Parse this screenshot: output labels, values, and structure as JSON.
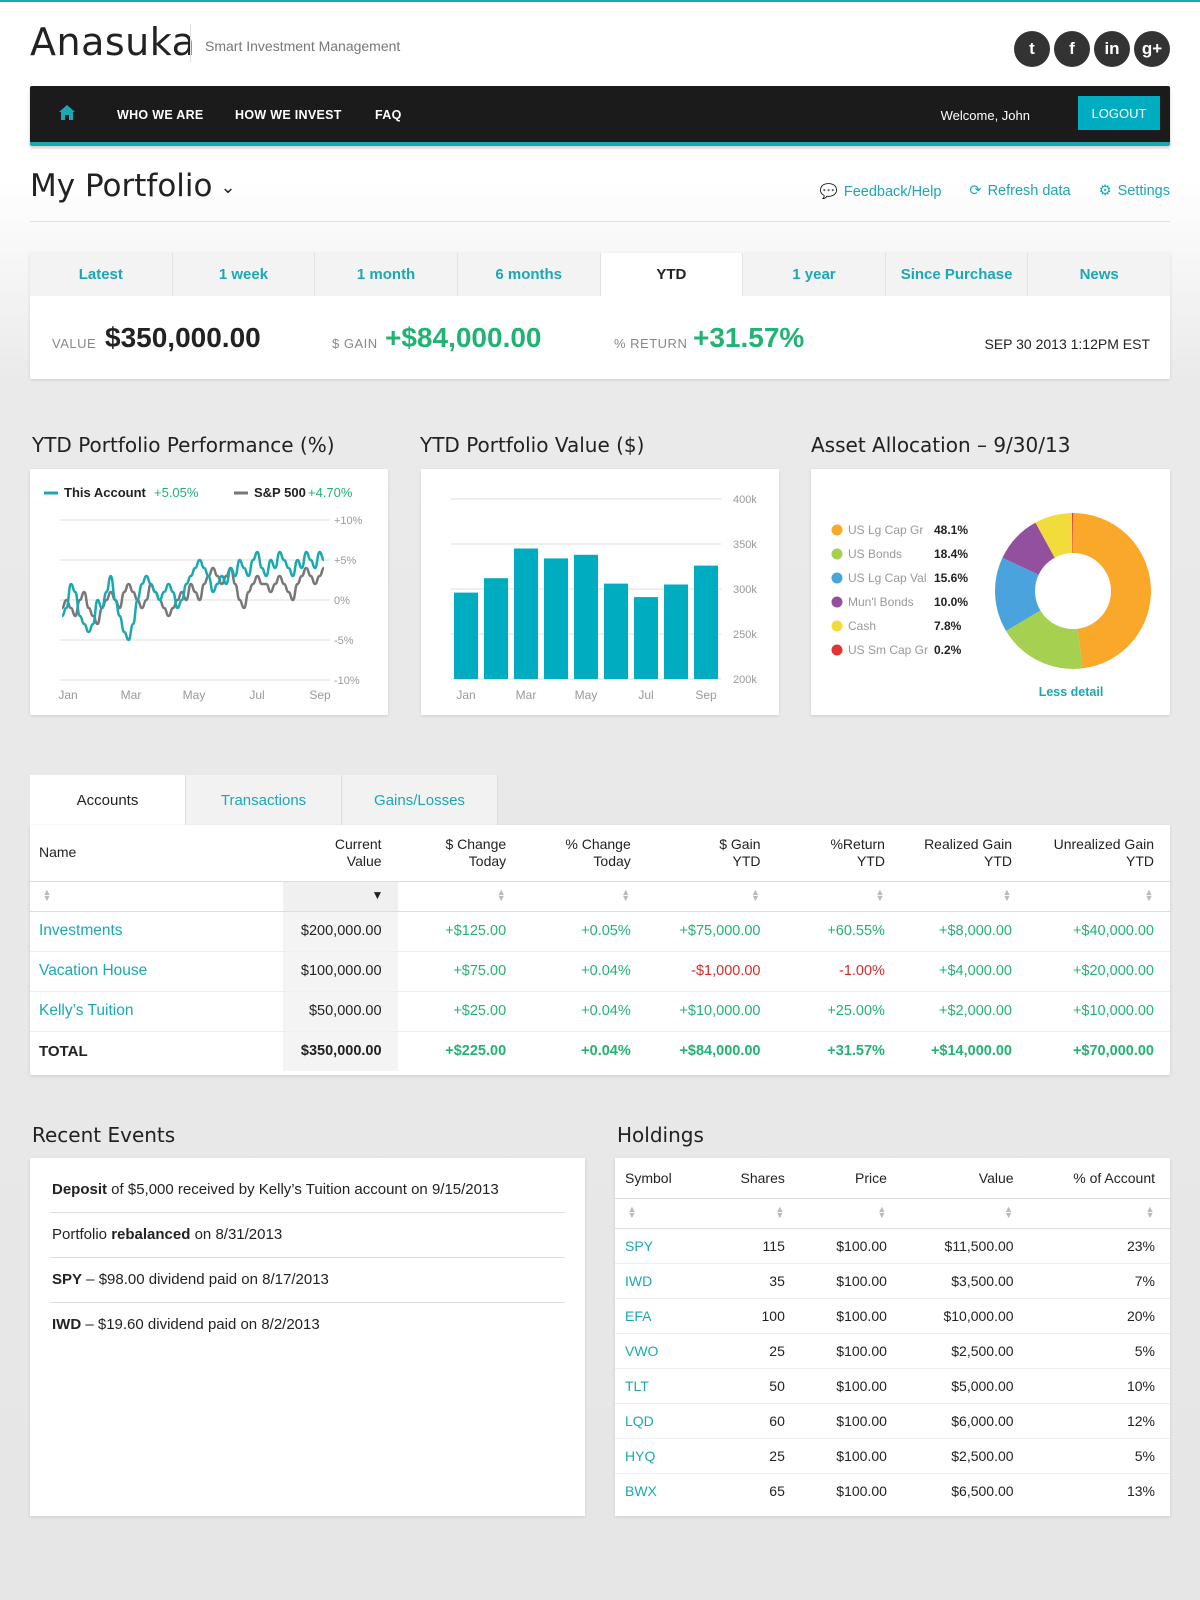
{
  "brand": {
    "name": "Anasuka",
    "tagline": "Smart Investment Management"
  },
  "social": [
    {
      "icon": "twitter-icon",
      "glyph": "t"
    },
    {
      "icon": "facebook-icon",
      "glyph": "f"
    },
    {
      "icon": "linkedin-icon",
      "glyph": "in"
    },
    {
      "icon": "googleplus-icon",
      "glyph": "g+"
    }
  ],
  "nav": {
    "items": [
      "WHO WE ARE",
      "HOW WE INVEST",
      "FAQ"
    ],
    "welcome": "Welcome, John",
    "logout": "LOGOUT"
  },
  "page": {
    "title": "My Portfolio"
  },
  "actions": {
    "feedback": "Feedback/Help",
    "refresh": "Refresh data",
    "settings": "Settings"
  },
  "time_tabs": [
    "Latest",
    "1 week",
    "1 month",
    "6 months",
    "YTD",
    "1 year",
    "Since Purchase",
    "News"
  ],
  "active_time_tab": "YTD",
  "summary": {
    "value_label": "VALUE",
    "value": "$350,000.00",
    "gain_label": "$ GAIN",
    "gain": "+$84,000.00",
    "return_label": "% RETURN",
    "return": "+31.57%",
    "date": "SEP 30 2013 1:12PM EST"
  },
  "charts": {
    "performance_title": "YTD Portfolio Performance (%)",
    "value_title": "YTD Portfolio Value ($)",
    "allocation_title": "Asset Allocation – 9/30/13",
    "less_detail": "Less detail"
  },
  "chart_data": [
    {
      "type": "line",
      "title": "YTD Portfolio Performance (%)",
      "x_ticks": [
        "Jan",
        "Mar",
        "May",
        "Jul",
        "Sep"
      ],
      "y_ticks": [
        "+10%",
        "+5%",
        "0%",
        "-5%",
        "-10%"
      ],
      "ylim": [
        -10,
        10
      ],
      "series": [
        {
          "name": "This Account",
          "legend_value": "+5.05%",
          "color": "#1aa8b3",
          "values": [
            -2,
            -1,
            2,
            1,
            -2,
            -3,
            -4,
            -3,
            0,
            -1,
            1,
            3,
            0,
            -2,
            -4,
            -5,
            -3,
            0,
            2,
            3,
            2,
            1,
            0,
            1,
            2,
            1,
            -1,
            0,
            2,
            3,
            4,
            5,
            4,
            3,
            1,
            2,
            3,
            2,
            4,
            3,
            5,
            4,
            3,
            5,
            6,
            4,
            3,
            5,
            4,
            6,
            5,
            4,
            3,
            5,
            4,
            6,
            5,
            4,
            6,
            5
          ]
        },
        {
          "name": "S&P 500",
          "legend_value": "+4.70%",
          "color": "#777777",
          "values": [
            -1,
            0,
            -1,
            -2,
            0,
            1,
            -1,
            -2,
            -3,
            -1,
            0,
            1,
            0,
            -1,
            1,
            2,
            1,
            0,
            -1,
            0,
            2,
            1,
            0,
            -1,
            -2,
            -1,
            0,
            1,
            0,
            2,
            1,
            0,
            2,
            3,
            4,
            3,
            2,
            3,
            4,
            2,
            0,
            -1,
            1,
            2,
            3,
            2,
            2,
            1,
            2,
            3,
            2,
            1,
            0,
            2,
            3,
            4,
            3,
            2,
            3,
            4
          ]
        }
      ]
    },
    {
      "type": "bar",
      "title": "YTD Portfolio Value ($)",
      "categories": [
        "Jan",
        "Feb",
        "Mar",
        "Apr",
        "May",
        "Jun",
        "Jul",
        "Aug",
        "Sep"
      ],
      "x_ticks": [
        "Jan",
        "Mar",
        "May",
        "Jul",
        "Sep"
      ],
      "y_ticks": [
        "400k",
        "350k",
        "300k",
        "250k",
        "200k"
      ],
      "values": [
        296000,
        312000,
        345000,
        334000,
        338000,
        306000,
        291000,
        305000,
        326000
      ],
      "ylim": [
        200000,
        400000
      ],
      "color": "#00adc0"
    },
    {
      "type": "pie",
      "title": "Asset Allocation – 9/30/13",
      "slices": [
        {
          "label": "US Lg Cap Gr",
          "value": 48.1,
          "display": "48.1%",
          "color": "#f9a82a"
        },
        {
          "label": "US Bonds",
          "value": 18.4,
          "display": "18.4%",
          "color": "#a6d150"
        },
        {
          "label": "US Lg Cap Val",
          "value": 15.6,
          "display": "15.6%",
          "color": "#4ba3de"
        },
        {
          "label": "Mun'l Bonds",
          "value": 10.0,
          "display": "10.0%",
          "color": "#93509e"
        },
        {
          "label": "Cash",
          "value": 7.8,
          "display": "7.8%",
          "color": "#f2dc3b"
        },
        {
          "label": "US Sm Cap Gr",
          "value": 0.2,
          "display": "0.2%",
          "color": "#e33333"
        }
      ]
    }
  ],
  "accounts": {
    "tabs": [
      "Accounts",
      "Transactions",
      "Gains/Losses"
    ],
    "columns": [
      "Name",
      "Current Value",
      "$ Change Today",
      "% Change Today",
      "$ Gain YTD",
      "%Return YTD",
      "Realized Gain YTD",
      "Unrealized Gain YTD"
    ],
    "rows": [
      {
        "name": "Investments",
        "cur": "$200,000.00",
        "chg": "+$125.00",
        "pchg": "+0.05%",
        "gain": "+$75,000.00",
        "ret": "+60.55%",
        "real": "+$8,000.00",
        "unreal": "+$40,000.00",
        "neg": false
      },
      {
        "name": "Vacation House",
        "cur": "$100,000.00",
        "chg": "+$75.00",
        "pchg": "+0.04%",
        "gain": "-$1,000.00",
        "ret": "-1.00%",
        "real": "+$4,000.00",
        "unreal": "+$20,000.00",
        "neg": true
      },
      {
        "name": "Kelly’s Tuition",
        "cur": "$50,000.00",
        "chg": "+$25.00",
        "pchg": "+0.04%",
        "gain": "+$10,000.00",
        "ret": "+25.00%",
        "real": "+$2,000.00",
        "unreal": "+$10,000.00",
        "neg": false
      }
    ],
    "total": {
      "name": "TOTAL",
      "cur": "$350,000.00",
      "chg": "+$225.00",
      "pchg": "+0.04%",
      "gain": "+$84,000.00",
      "ret": "+31.57%",
      "real": "+$14,000.00",
      "unreal": "+$70,000.00"
    }
  },
  "events": {
    "title": "Recent Events",
    "items": [
      {
        "bold": "Deposit",
        "text": " of $5,000 received by Kelly’s Tuition account on 9/15/2013",
        "prefix": ""
      },
      {
        "prefix": "Portfolio ",
        "bold": "rebalanced",
        "text": " on 8/31/2013"
      },
      {
        "bold": "SPY",
        "text": " – $98.00 dividend paid on 8/17/2013",
        "prefix": ""
      },
      {
        "bold": "IWD",
        "text": " – $19.60 dividend paid on 8/2/2013",
        "prefix": ""
      }
    ]
  },
  "holdings": {
    "title": "Holdings",
    "columns": [
      "Symbol",
      "Shares",
      "Price",
      "Value",
      "% of Account"
    ],
    "rows": [
      [
        "SPY",
        "115",
        "$100.00",
        "$11,500.00",
        "23%"
      ],
      [
        "IWD",
        "35",
        "$100.00",
        "$3,500.00",
        "7%"
      ],
      [
        "EFA",
        "100",
        "$100.00",
        "$10,000.00",
        "20%"
      ],
      [
        "VWO",
        "25",
        "$100.00",
        "$2,500.00",
        "5%"
      ],
      [
        "TLT",
        "50",
        "$100.00",
        "$5,000.00",
        "10%"
      ],
      [
        "LQD",
        "60",
        "$100.00",
        "$6,000.00",
        "12%"
      ],
      [
        "HYQ",
        "25",
        "$100.00",
        "$2,500.00",
        "5%"
      ],
      [
        "BWX",
        "65",
        "$100.00",
        "$6,500.00",
        "13%"
      ]
    ]
  }
}
